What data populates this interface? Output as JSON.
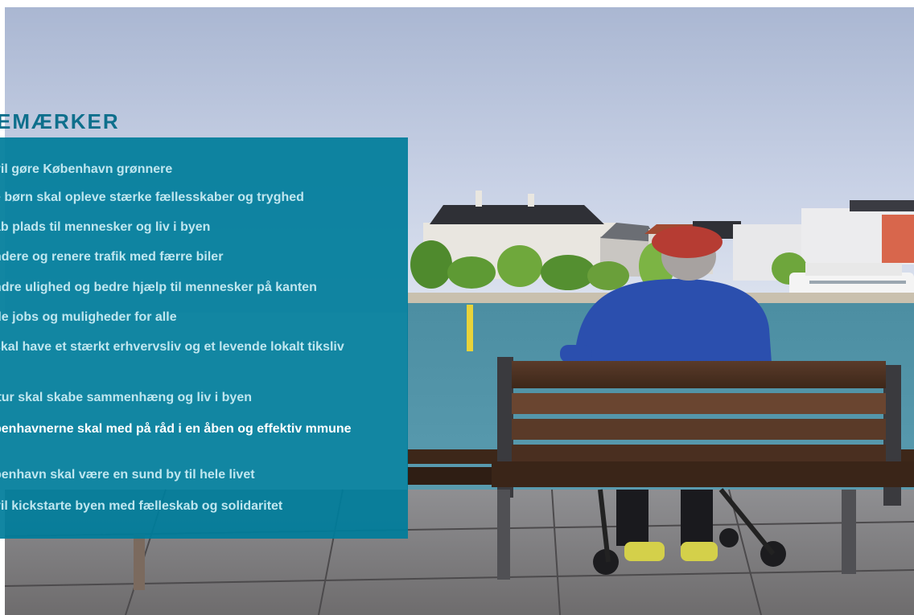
{
  "heading": "EMÆRKER",
  "links": [
    {
      "label": "vil gøre København grønnere"
    },
    {
      "label": "e børn skal opleve stærke fællesskaber og tryghed"
    },
    {
      "label": "ab plads til mennesker og liv i byen"
    },
    {
      "label": "ndere og renere trafik med færre biler"
    },
    {
      "label": "ndre ulighed og bedre hjælp til mennesker på kanten"
    },
    {
      "label": "de jobs og muligheder for alle"
    },
    {
      "label": "skal have et stærkt erhvervsliv og et levende lokalt tiksliv"
    },
    {
      "label": "ltur skal skabe sammenhæng og liv i byen"
    },
    {
      "label": "benhavnerne skal med på råd i en åben og effektiv mmune",
      "active": true
    },
    {
      "label": "benhavn skal være en sund by til hele livet"
    },
    {
      "label": "vil kickstarte byen med fælleskab og solidaritet"
    }
  ],
  "colors": {
    "panel": "#007d9b",
    "heading": "#0e6f8c",
    "link": "#bfe6ef",
    "link_active": "#ffffff"
  }
}
